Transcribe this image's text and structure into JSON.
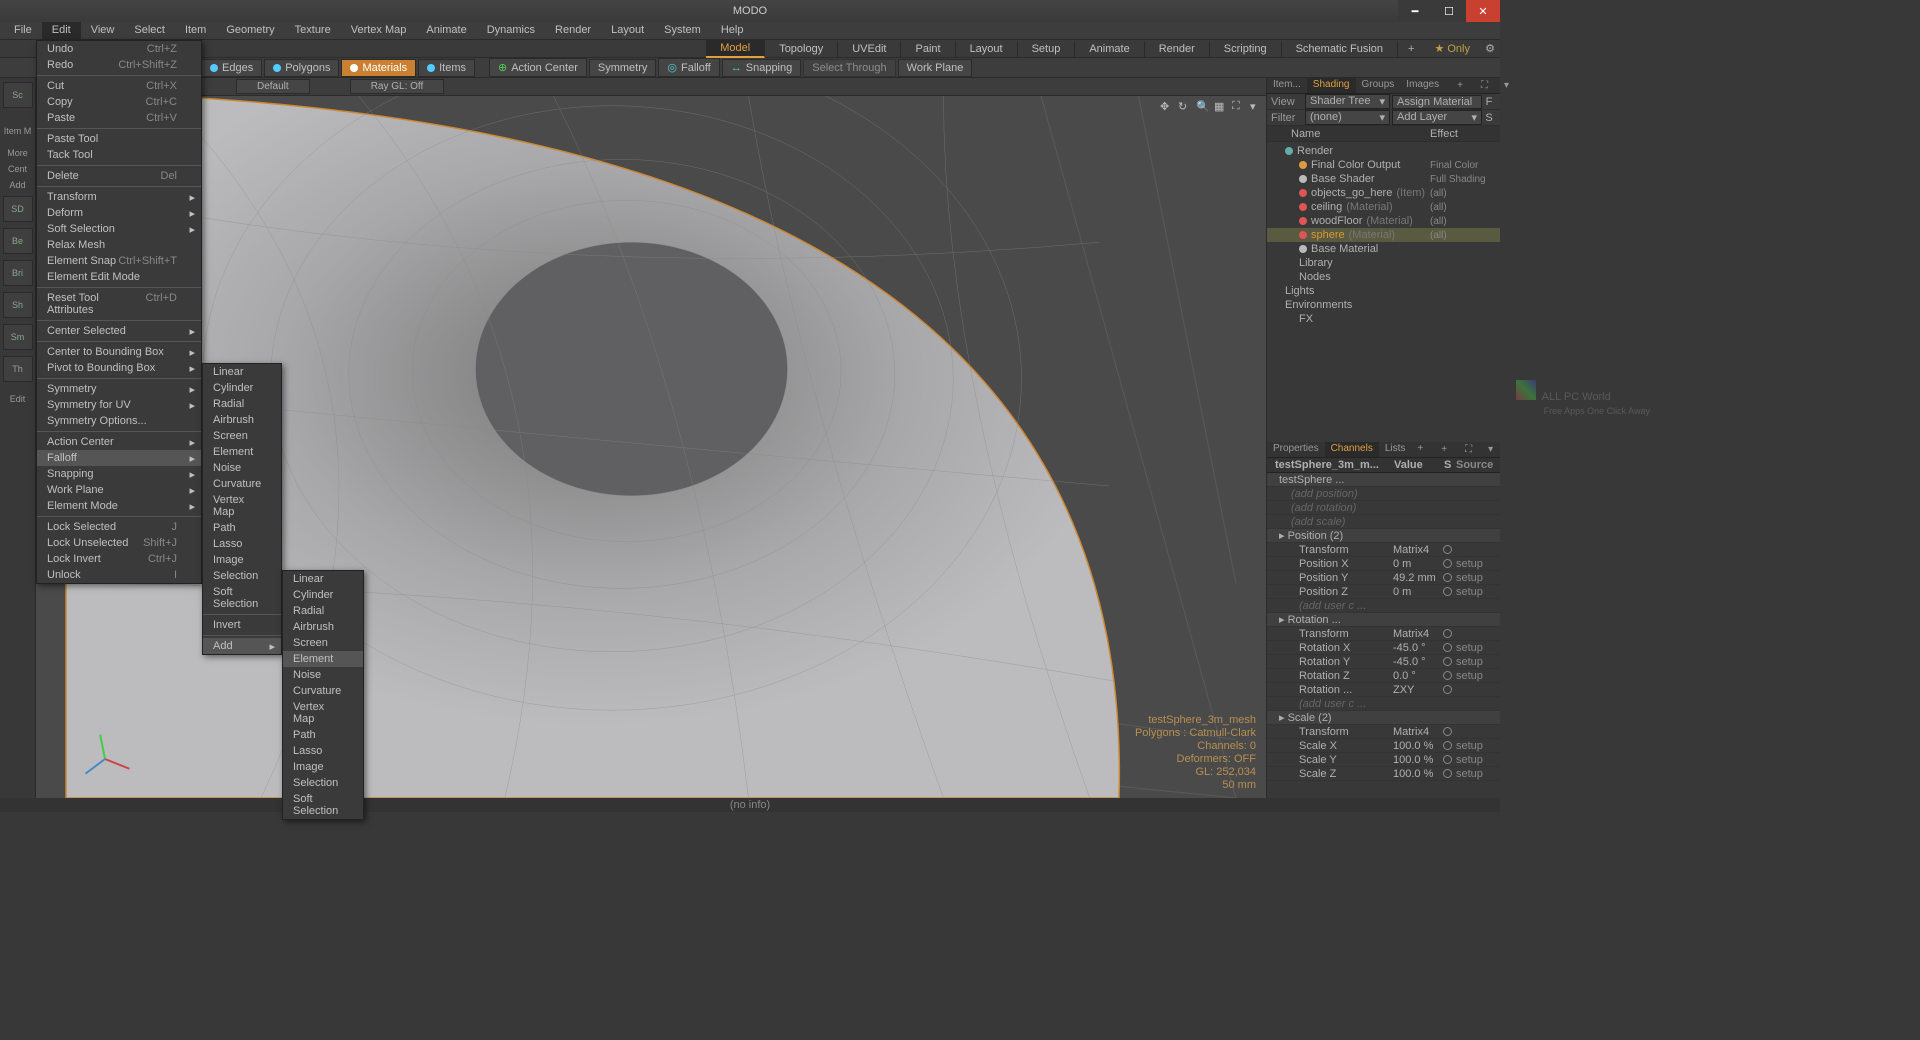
{
  "titlebar": {
    "title": "MODO"
  },
  "menubar": [
    "File",
    "Edit",
    "View",
    "Select",
    "Item",
    "Geometry",
    "Texture",
    "Vertex Map",
    "Animate",
    "Dynamics",
    "Render",
    "Layout",
    "System",
    "Help"
  ],
  "workspaces": [
    "Model",
    "Topology",
    "UVEdit",
    "Paint",
    "Layout",
    "Setup",
    "Animate",
    "Render",
    "Scripting",
    "Schematic Fusion"
  ],
  "workspace_active": "Model",
  "workspace_only": "Only",
  "toolbar": {
    "edges": "Edges",
    "polygons": "Polygons",
    "materials": "Materials",
    "items": "Items",
    "action_center": "Action Center",
    "symmetry": "Symmetry",
    "falloff": "Falloff",
    "snapping": "Snapping",
    "select_through": "Select Through",
    "work_plane": "Work Plane"
  },
  "vp_pills": {
    "default": "Default",
    "raygl": "Ray GL: Off"
  },
  "edit_menu": [
    {
      "label": "Undo",
      "short": "Ctrl+Z"
    },
    {
      "label": "Redo",
      "short": "Ctrl+Shift+Z"
    },
    {
      "sep": true
    },
    {
      "label": "Cut",
      "short": "Ctrl+X"
    },
    {
      "label": "Copy",
      "short": "Ctrl+C"
    },
    {
      "label": "Paste",
      "short": "Ctrl+V"
    },
    {
      "sep": true
    },
    {
      "label": "Paste Tool"
    },
    {
      "label": "Tack Tool"
    },
    {
      "sep": true
    },
    {
      "label": "Delete",
      "short": "Del"
    },
    {
      "sep": true
    },
    {
      "label": "Transform",
      "sub": true
    },
    {
      "label": "Deform",
      "sub": true
    },
    {
      "label": "Soft Selection",
      "sub": true
    },
    {
      "label": "Relax Mesh"
    },
    {
      "label": "Element Snap",
      "short": "Ctrl+Shift+T"
    },
    {
      "label": "Element Edit Mode"
    },
    {
      "sep": true
    },
    {
      "label": "Reset Tool Attributes",
      "short": "Ctrl+D"
    },
    {
      "sep": true
    },
    {
      "label": "Center Selected",
      "sub": true
    },
    {
      "sep": true
    },
    {
      "label": "Center to Bounding Box",
      "sub": true
    },
    {
      "label": "Pivot to Bounding Box",
      "sub": true
    },
    {
      "sep": true
    },
    {
      "label": "Symmetry",
      "sub": true
    },
    {
      "label": "Symmetry for UV",
      "sub": true
    },
    {
      "label": "Symmetry Options..."
    },
    {
      "sep": true
    },
    {
      "label": "Action Center",
      "sub": true
    },
    {
      "label": "Falloff",
      "sub": true,
      "hl": true
    },
    {
      "label": "Snapping",
      "sub": true
    },
    {
      "label": "Work Plane",
      "sub": true
    },
    {
      "label": "Element Mode",
      "sub": true
    },
    {
      "sep": true
    },
    {
      "label": "Lock Selected",
      "short": "J"
    },
    {
      "label": "Lock Unselected",
      "short": "Shift+J"
    },
    {
      "label": "Lock Invert",
      "short": "Ctrl+J"
    },
    {
      "label": "Unlock",
      "short": "I"
    }
  ],
  "falloff_menu": [
    "Linear",
    "Cylinder",
    "Radial",
    "Airbrush",
    "Screen",
    "Element",
    "Noise",
    "Curvature",
    "Vertex Map",
    "Path",
    "Lasso",
    "Image",
    "Selection",
    "Soft Selection",
    "",
    "Invert",
    "",
    "Add"
  ],
  "add_menu": [
    "Linear",
    "Cylinder",
    "Radial",
    "Airbrush",
    "Screen",
    "Element",
    "Noise",
    "Curvature",
    "Vertex Map",
    "Path",
    "Lasso",
    "Image",
    "Selection",
    "Soft Selection"
  ],
  "add_hl": "Element",
  "left_items": [
    "Sc",
    "",
    "",
    "Item M",
    "",
    "More",
    "Cent",
    "Add",
    "SD",
    "Be",
    "Bri",
    "Sh",
    "Sm",
    "Th",
    "",
    "Edit"
  ],
  "vp_info": {
    "mesh": "testSphere_3m_mesh",
    "poly": "Polygons : Catmull-Clark",
    "chan": "Channels: 0",
    "def": "Deformers: OFF",
    "gl": "GL: 252,034",
    "scale": "50 mm"
  },
  "rtabs_top": [
    "Item...",
    "Shading",
    "Groups",
    "Images"
  ],
  "shading": {
    "view_label": "View",
    "view": "Shader Tree",
    "assign": "Assign Material",
    "filter_label": "Filter",
    "filter": "(none)",
    "addlayer": "Add Layer",
    "cols": {
      "name": "Name",
      "effect": "Effect"
    }
  },
  "tree": [
    {
      "ind": 1,
      "icon": "#6aa",
      "label": "Render",
      "eff": ""
    },
    {
      "ind": 2,
      "icon": "#d94",
      "label": "Final Color Output",
      "eff": "Final Color"
    },
    {
      "ind": 2,
      "icon": "#bbb",
      "label": "Base Shader",
      "eff": "Full Shading"
    },
    {
      "ind": 2,
      "icon": "#d55",
      "label": "objects_go_here",
      "hint": "(Item)",
      "eff": "(all)"
    },
    {
      "ind": 2,
      "icon": "#d55",
      "label": "ceiling",
      "hint": "(Material)",
      "eff": "(all)"
    },
    {
      "ind": 2,
      "icon": "#d55",
      "label": "woodFloor",
      "hint": "(Material)",
      "eff": "(all)"
    },
    {
      "ind": 2,
      "icon": "#d55",
      "label": "sphere",
      "hint": "(Material)",
      "eff": "(all)",
      "sel": true
    },
    {
      "ind": 2,
      "icon": "#bbb",
      "label": "Base Material",
      "eff": ""
    },
    {
      "ind": 2,
      "icon": "",
      "label": "Library",
      "eff": ""
    },
    {
      "ind": 2,
      "icon": "",
      "label": "Nodes",
      "eff": ""
    },
    {
      "ind": 1,
      "icon": "",
      "label": "Lights",
      "eff": ""
    },
    {
      "ind": 1,
      "icon": "",
      "label": "Environments",
      "eff": ""
    },
    {
      "ind": 2,
      "icon": "",
      "label": "FX",
      "eff": ""
    }
  ],
  "rtabs_bot": [
    "Properties",
    "Channels",
    "Lists",
    "+"
  ],
  "ch_cols": {
    "name": "testSphere_3m_m...",
    "value": "Value",
    "s": "S",
    "source": "Source"
  },
  "channels": {
    "groupTop": "testSphere ...",
    "adds": [
      "(add position)",
      "(add rotation)",
      "(add scale)"
    ],
    "pos": {
      "title": "Position (2)",
      "transform": "Transform",
      "tval": "Matrix4",
      "rows": [
        {
          "n": "Position X",
          "v": "0 m",
          "s": "setup"
        },
        {
          "n": "Position Y",
          "v": "49.2 mm",
          "s": "setup"
        },
        {
          "n": "Position Z",
          "v": "0 m",
          "s": "setup"
        }
      ],
      "add": "(add user c ..."
    },
    "rot": {
      "title": "Rotation ...",
      "transform": "Transform",
      "tval": "Matrix4",
      "rows": [
        {
          "n": "Rotation X",
          "v": "-45.0 °",
          "s": "setup"
        },
        {
          "n": "Rotation Y",
          "v": "-45.0 °",
          "s": "setup"
        },
        {
          "n": "Rotation Z",
          "v": "0.0 °",
          "s": "setup"
        },
        {
          "n": "Rotation ...",
          "v": "ZXY",
          "s": ""
        }
      ],
      "add": "(add user c ..."
    },
    "scl": {
      "title": "Scale (2)",
      "transform": "Transform",
      "tval": "Matrix4",
      "rows": [
        {
          "n": "Scale X",
          "v": "100.0 %",
          "s": "setup"
        },
        {
          "n": "Scale Y",
          "v": "100.0 %",
          "s": "setup"
        },
        {
          "n": "Scale Z",
          "v": "100.0 %",
          "s": "setup"
        }
      ]
    }
  },
  "statusbar": "(no info)",
  "watermark": {
    "text": "ALL PC World",
    "sub": "Free Apps One Click Away"
  }
}
